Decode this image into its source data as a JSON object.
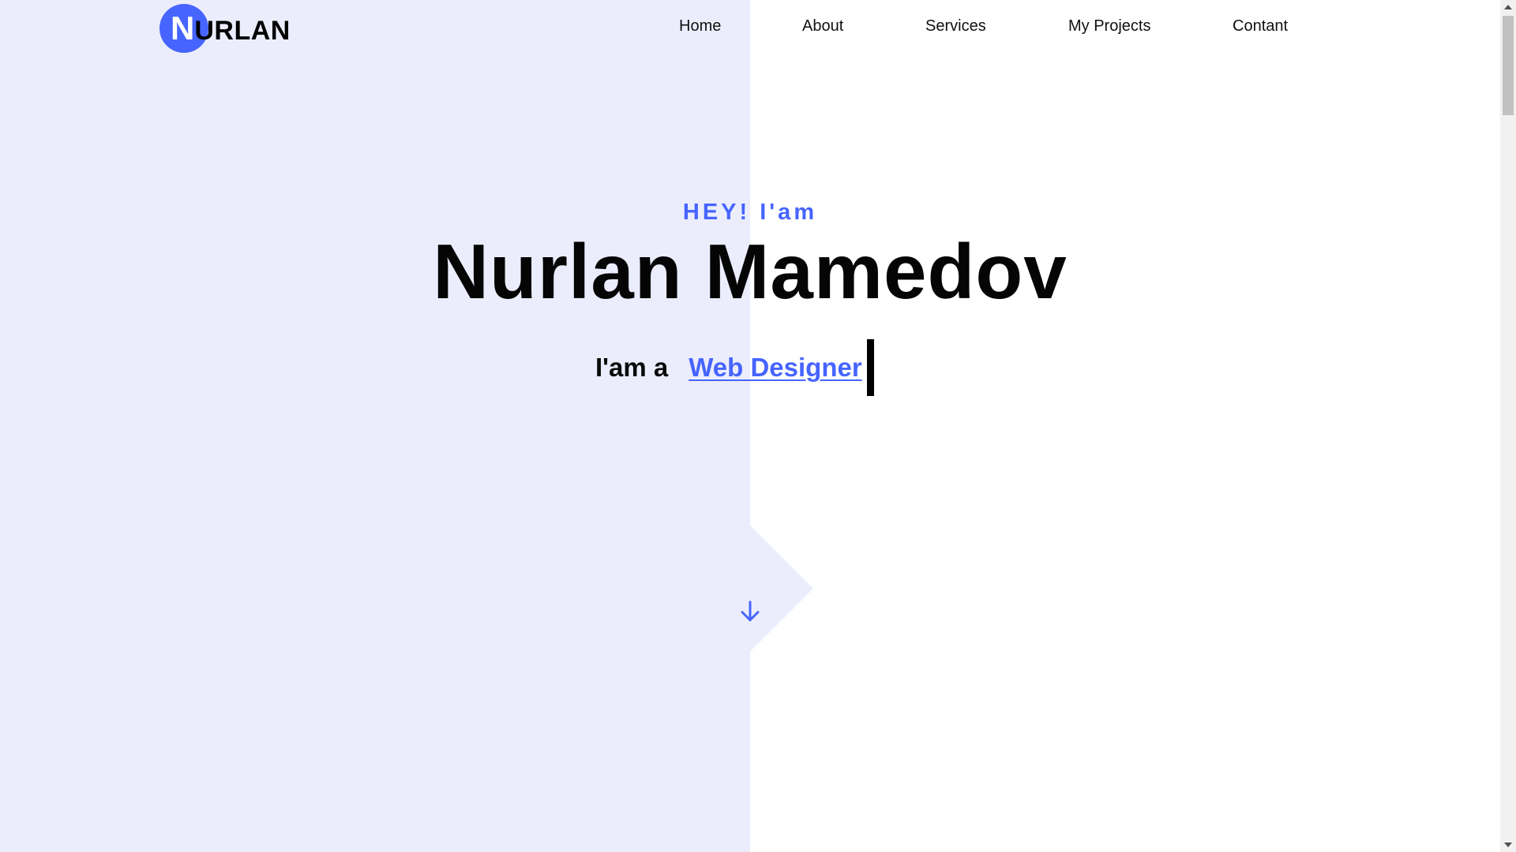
{
  "brand": {
    "logo_initial": "N",
    "logo_rest": "URLAN",
    "accent_color": "#4664ff"
  },
  "nav": {
    "items": [
      {
        "label": "Home"
      },
      {
        "label": "About"
      },
      {
        "label": "Services"
      },
      {
        "label": "My Projects"
      },
      {
        "label": "Contant"
      }
    ]
  },
  "hero": {
    "kicker": "HEY! I'am",
    "name": "Nurlan Mamedov",
    "role_prefix": "I'am a",
    "role_value": "Web Designer",
    "scroll_icon": "arrow-down-icon"
  },
  "colors": {
    "left_panel": "#ebedfd",
    "right_panel": "#ffffff",
    "text": "#050505"
  }
}
